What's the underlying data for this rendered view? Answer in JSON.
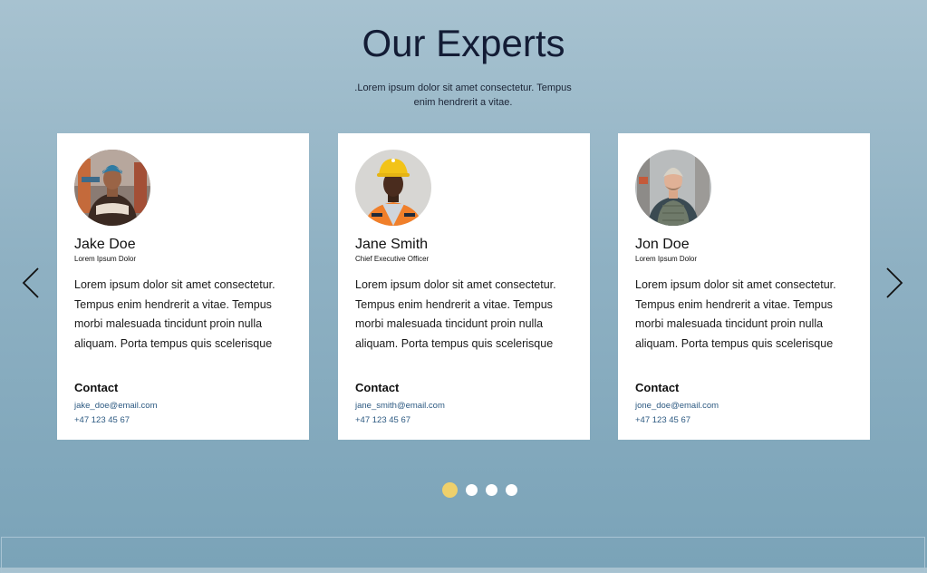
{
  "section": {
    "title": "Our Experts",
    "subtitle": ".Lorem ipsum dolor sit amet consectetur. Tempus enim hendrerit a vitae."
  },
  "experts": [
    {
      "name": "Jake Doe",
      "role": "Lorem Ipsum Dolor",
      "bio": "Lorem ipsum dolor sit amet consectetur. Tempus enim hendrerit a vitae. Tempus morbi malesuada tincidunt proin nulla aliquam. Porta tempus quis scelerisque",
      "contact_label": "Contact",
      "email": "jake_doe@email.com",
      "phone": "+47 123 45 67"
    },
    {
      "name": "Jane Smith",
      "role": "Chief Executive Officer",
      "bio": "Lorem ipsum dolor sit amet consectetur. Tempus enim hendrerit a vitae. Tempus morbi malesuada tincidunt proin nulla aliquam. Porta tempus quis scelerisque",
      "contact_label": "Contact",
      "email": "jane_smith@email.com",
      "phone": "+47 123 45 67"
    },
    {
      "name": "Jon Doe",
      "role": "Lorem Ipsum Dolor",
      "bio": "Lorem ipsum dolor sit amet consectetur. Tempus enim hendrerit a vitae. Tempus morbi malesuada tincidunt proin nulla aliquam. Porta tempus quis scelerisque",
      "contact_label": "Contact",
      "email": "jone_doe@email.com",
      "phone": "+47 123 45 67"
    }
  ],
  "carousel": {
    "prev_icon": "chevron-left-icon",
    "next_icon": "chevron-right-icon",
    "page_count": 4,
    "active_page": 1
  },
  "colors": {
    "background_top": "#a7c2d0",
    "background_bottom": "#7aa3b8",
    "title": "#131c35",
    "link": "#2d5a82",
    "active_dot": "#efd06b",
    "inactive_dot": "#ffffff"
  }
}
